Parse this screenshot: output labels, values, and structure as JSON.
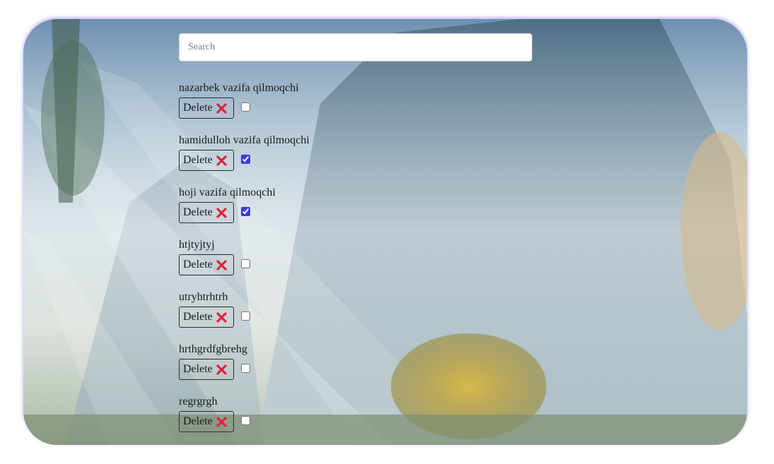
{
  "search": {
    "placeholder": "Search"
  },
  "todos": [
    {
      "title": "nazarbek vazifa qilmoqchi",
      "done": false
    },
    {
      "title": "hamidulloh vazifa qilmoqchi",
      "done": true
    },
    {
      "title": "hoji vazifa qilmoqchi",
      "done": true
    },
    {
      "title": "htjtyjtyj",
      "done": false
    },
    {
      "title": "utryhtrhtrh",
      "done": false
    },
    {
      "title": "hrthgrdfgbrehg",
      "done": false
    },
    {
      "title": "regrgrgh",
      "done": false
    }
  ],
  "labels": {
    "delete": "Delete"
  },
  "icons": {
    "delete": "cross-mark-icon"
  },
  "colors": {
    "accent": "#3b3bd8",
    "cross": "#e0223b"
  }
}
